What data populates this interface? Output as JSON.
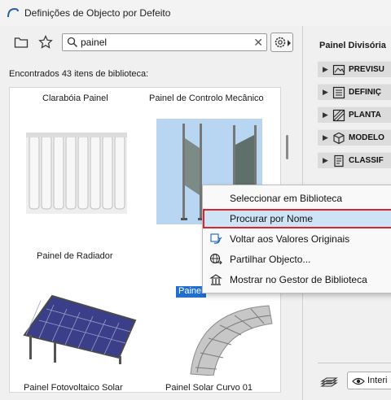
{
  "window": {
    "title": "Definições de Objecto por Defeito"
  },
  "toolbar": {
    "search_value": "painel",
    "folder_icon": "folder-icon",
    "star_icon": "star-icon",
    "gear_icon": "gear-icon"
  },
  "results": {
    "found_text": "Encontrados 43 itens de biblioteca:"
  },
  "library": {
    "items": [
      {
        "label": "Clarabóia Painel"
      },
      {
        "label": "Painel de Controlo Mecânico"
      },
      {
        "label": "Painel de Radiador"
      },
      {
        "label": "Painel"
      },
      {
        "label": "Painel Fotovoltaico Solar"
      },
      {
        "label": "Painel Solar Curvo 01"
      }
    ]
  },
  "context_menu": {
    "items": [
      {
        "label": "Seleccionar em Biblioteca",
        "icon": ""
      },
      {
        "label": "Procurar por Nome",
        "icon": "",
        "highlighted": true
      },
      {
        "label": "Voltar aos Valores Originais",
        "icon": "reset-icon"
      },
      {
        "label": "Partilhar Objecto...",
        "icon": "share-globe-icon"
      },
      {
        "label": "Mostrar no Gestor de Biblioteca",
        "icon": "library-manager-icon"
      }
    ]
  },
  "right_panel": {
    "title": "Painel Divisória",
    "sections": [
      {
        "label": "PREVISU",
        "icon": "preview-icon"
      },
      {
        "label": "DEFINIÇ",
        "icon": "settings-list-icon"
      },
      {
        "label": "PLANTA",
        "icon": "floor-plan-icon"
      },
      {
        "label": "MODELO",
        "icon": "cube-icon"
      },
      {
        "label": "CLASSIF",
        "icon": "classification-icon"
      }
    ],
    "view_button_label": "Interi"
  },
  "colors": {
    "selection": "#1f6fd0",
    "highlight_border": "#d9262e",
    "selected_thumb_bg": "#b8d6f2"
  }
}
